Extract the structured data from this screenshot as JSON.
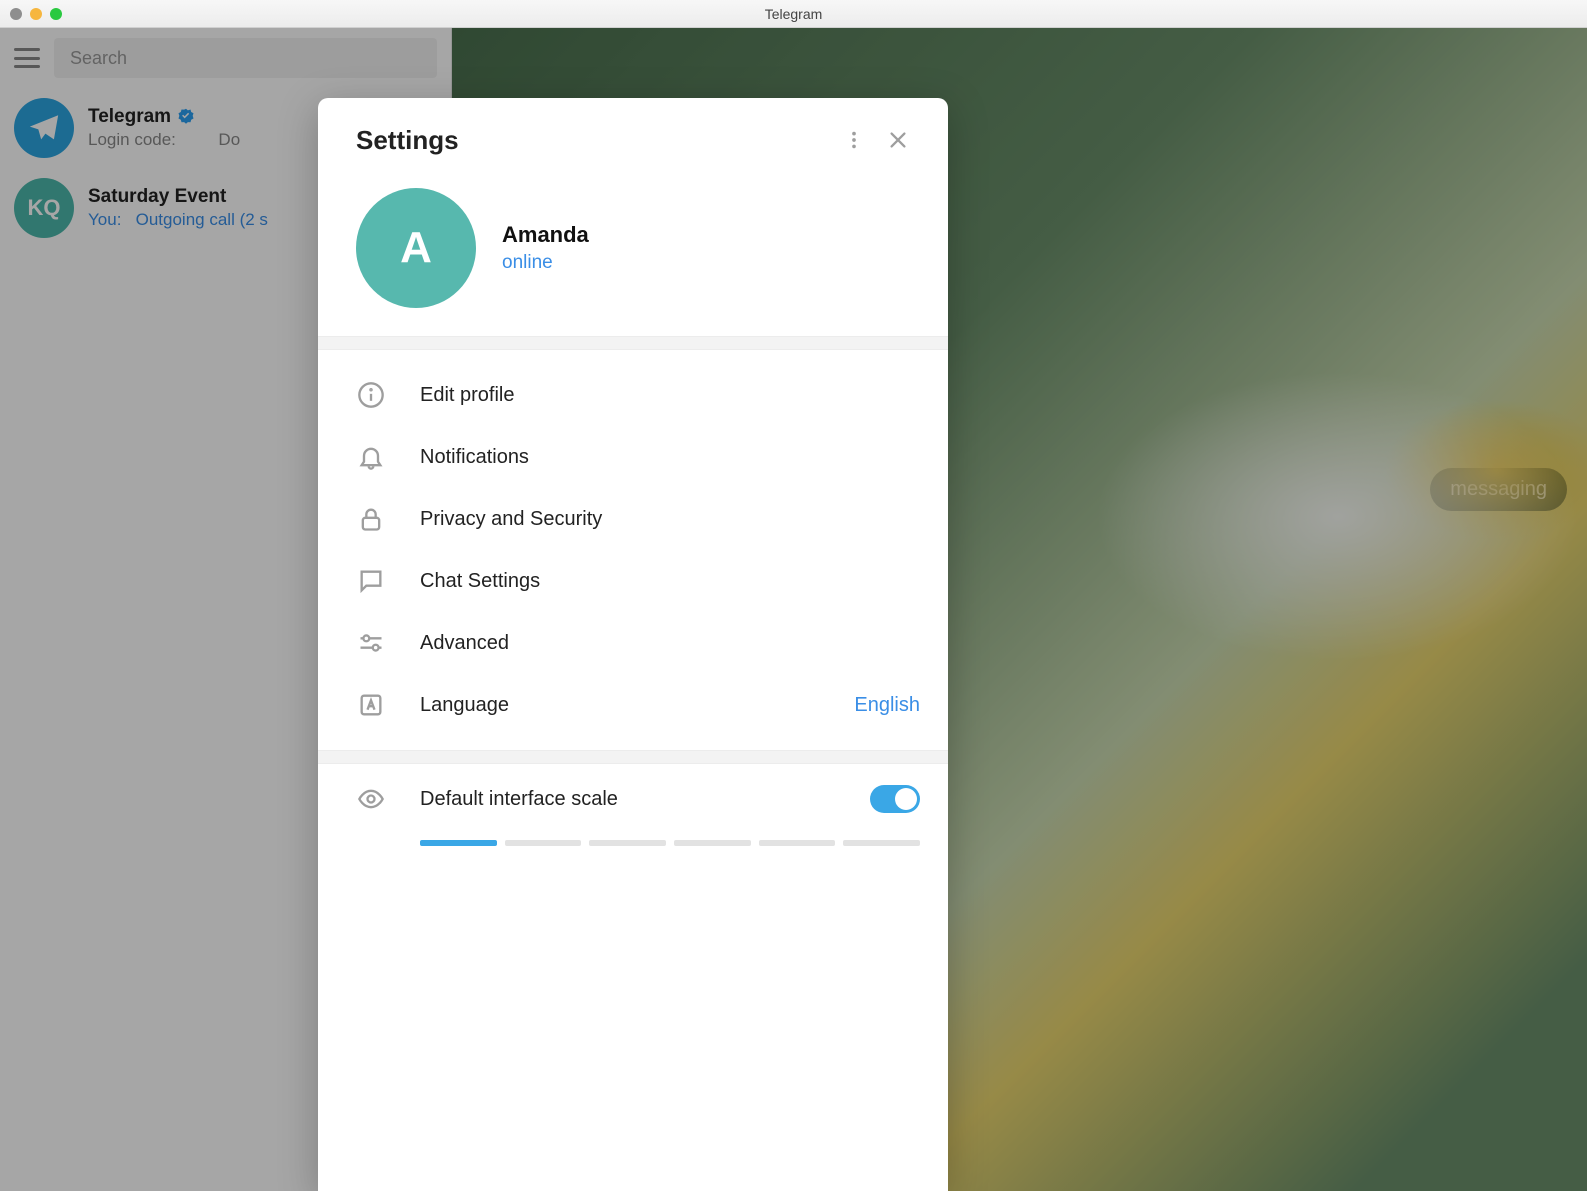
{
  "window": {
    "title": "Telegram"
  },
  "sidebar": {
    "search_placeholder": "Search",
    "chats": [
      {
        "name": "Telegram",
        "subtitle_prefix": "Login code:",
        "subtitle_rest": "Do",
        "avatar": "TG",
        "verified": true
      },
      {
        "name": "Saturday Event",
        "you": "You:",
        "subtitle": "Outgoing call (2 s",
        "avatar": "KQ",
        "verified": false
      }
    ]
  },
  "empty_hint": "messaging",
  "settings": {
    "title": "Settings",
    "profile": {
      "initial": "A",
      "name": "Amanda",
      "status": "online"
    },
    "items": [
      {
        "key": "edit",
        "label": "Edit profile"
      },
      {
        "key": "notif",
        "label": "Notifications"
      },
      {
        "key": "privacy",
        "label": "Privacy and Security"
      },
      {
        "key": "chat",
        "label": "Chat Settings"
      },
      {
        "key": "advanced",
        "label": "Advanced"
      },
      {
        "key": "language",
        "label": "Language",
        "value": "English"
      }
    ],
    "scale": {
      "label": "Default interface scale",
      "enabled": true,
      "active_segment": 0,
      "segments": 6
    }
  }
}
